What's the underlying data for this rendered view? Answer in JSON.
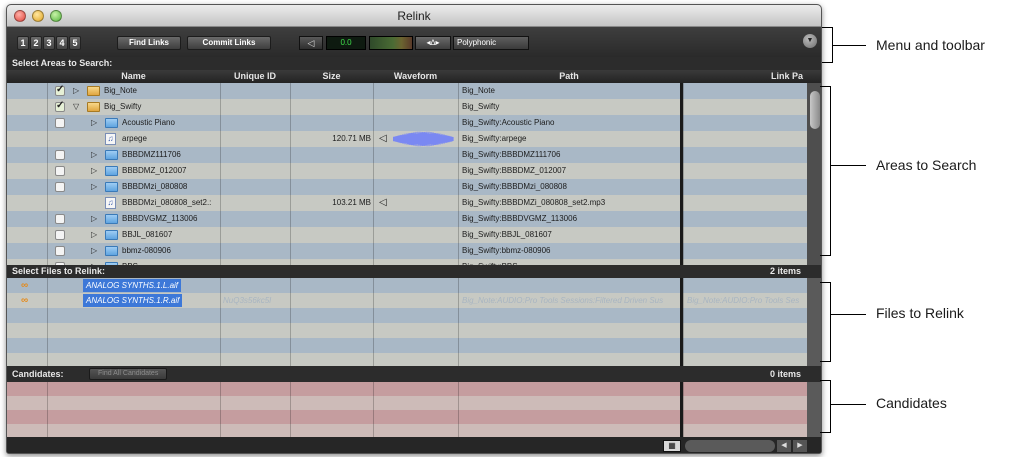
{
  "window": {
    "title": "Relink"
  },
  "toolbar": {
    "numbers": [
      "1",
      "2",
      "3",
      "4",
      "5"
    ],
    "find_links": "Find Links",
    "commit_links": "Commit Links",
    "counter": "0.0",
    "voice_mode": "Polyphonic"
  },
  "areas": {
    "title": "Select Areas to Search:",
    "columns": [
      "Name",
      "Unique ID",
      "Size",
      "Waveform",
      "Path",
      "Link Pa"
    ],
    "rows": [
      {
        "name": "Big_Note",
        "path": "Big_Note",
        "size": "",
        "checked": true,
        "expanded": false,
        "indent": 0,
        "icon": "gold-folder-icon"
      },
      {
        "name": "Big_Swifty",
        "path": "Big_Swifty",
        "size": "",
        "checked": true,
        "expanded": true,
        "indent": 0,
        "icon": "gold-folder-icon"
      },
      {
        "name": "Acoustic Piano",
        "path": "Big_Swifty:Acoustic Piano",
        "size": "",
        "checked": false,
        "expanded": false,
        "indent": 1,
        "icon": "folder-icon"
      },
      {
        "name": "arpege",
        "path": "Big_Swifty:arpege",
        "size": "120.71 MB",
        "checked": null,
        "indent": 1,
        "icon": "audio-file-icon",
        "waveform": true
      },
      {
        "name": "BBBDMZ111706",
        "path": "Big_Swifty:BBBDMZ111706",
        "size": "",
        "checked": false,
        "expanded": false,
        "indent": 1,
        "icon": "folder-icon"
      },
      {
        "name": "BBBDMZ_012007",
        "path": "Big_Swifty:BBBDMZ_012007",
        "size": "",
        "checked": false,
        "expanded": false,
        "indent": 1,
        "icon": "folder-icon"
      },
      {
        "name": "BBBDMzi_080808",
        "path": "Big_Swifty:BBBDMzi_080808",
        "size": "",
        "checked": false,
        "expanded": false,
        "indent": 1,
        "icon": "folder-icon"
      },
      {
        "name": "BBBDMzi_080808_set2.:",
        "path": "Big_Swifty:BBBDMZi_080808_set2.mp3",
        "size": "103.21 MB",
        "checked": null,
        "indent": 1,
        "icon": "audio-file-icon",
        "waveform": false
      },
      {
        "name": "BBBDVGMZ_113006",
        "path": "Big_Swifty:BBBDVGMZ_113006",
        "size": "",
        "checked": false,
        "expanded": false,
        "indent": 1,
        "icon": "folder-icon"
      },
      {
        "name": "BBJL_081607",
        "path": "Big_Swifty:BBJL_081607",
        "size": "",
        "checked": false,
        "expanded": false,
        "indent": 1,
        "icon": "folder-icon"
      },
      {
        "name": "bbmz-080906",
        "path": "Big_Swifty:bbmz-080906",
        "size": "",
        "checked": false,
        "expanded": false,
        "indent": 1,
        "icon": "folder-icon"
      },
      {
        "name": "BBS",
        "path": "Big_Swifty:BBS",
        "size": "",
        "checked": false,
        "expanded": false,
        "indent": 1,
        "icon": "folder-icon"
      }
    ]
  },
  "files": {
    "title": "Select Files to Relink:",
    "count": "2 items",
    "rows": [
      {
        "name": "ANALOG SYNTHS.1.L.aif",
        "unique_id": "",
        "path": "",
        "link_path": ""
      },
      {
        "name": "ANALOG SYNTHS.1.R.aif",
        "unique_id": "NuQ3s56kc5l",
        "path": "Big_Note:AUDIO:Pro Tools Sessions:Filtered Driven Sus",
        "link_path": "Big_Note:AUDIO:Pro Tools Ses"
      }
    ]
  },
  "candidates": {
    "title": "Candidates:",
    "find_all": "Find All Candidates",
    "count": "0 items"
  },
  "annotations": [
    "Menu and toolbar",
    "Areas to Search",
    "Files to Relink",
    "Candidates"
  ],
  "colors": {
    "row_a": "#a9b8c6",
    "row_b": "#c7c9c3",
    "cand_a": "#c59d9f",
    "cand_b": "#cdbbb8",
    "selection": "#3d78d8"
  }
}
